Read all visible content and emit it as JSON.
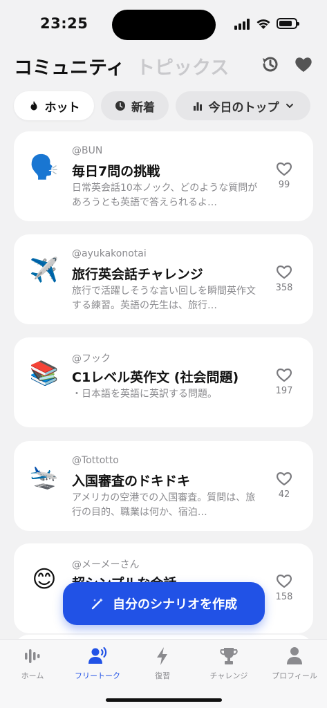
{
  "status": {
    "time": "23:25"
  },
  "header": {
    "tab_community": "コミュニティ",
    "tab_topics": "トピックス",
    "history_icon": "history-icon",
    "favorites_icon": "heart-icon"
  },
  "filters": {
    "hot": "ホット",
    "new": "新着",
    "top_today": "今日のトップ"
  },
  "cards": [
    {
      "emoji": "🗣️",
      "author": "@BUN",
      "title": "毎日7問の挑戦",
      "desc": "日常英会話10本ノック、どのような質問があろうとも英語で答えられるよ…",
      "likes": "99"
    },
    {
      "emoji": "✈️",
      "author": "@ayukakonotai",
      "title": "旅行英会話チャレンジ",
      "desc": "旅行で活躍しそうな言い回しを瞬間英作文する練習。英語の先生は、旅行…",
      "likes": "358"
    },
    {
      "emoji": "📚",
      "author": "@フック",
      "title": "C1レベル英作文 (社会問題)",
      "desc": "・日本語を英語に英訳する問題。",
      "likes": "197"
    },
    {
      "emoji": "🛬",
      "author": "@Tottotto",
      "title": "入国審査のドキドキ",
      "desc": "アメリカの空港での入国審査。質問は、旅行の目的、職業は何か、宿泊…",
      "likes": "42"
    },
    {
      "emoji": "😊",
      "author": "@メーメーさん",
      "title": "超シンプルな会話",
      "desc": "",
      "likes": "158"
    }
  ],
  "create_button": {
    "label": "自分のシナリオを作成"
  },
  "tabbar": {
    "home": "ホーム",
    "free_talk": "フリートーク",
    "review": "復習",
    "challenge": "チャレンジ",
    "profile": "プロフィール"
  },
  "colors": {
    "accent": "#2152e6",
    "background": "#f2f2f3"
  }
}
